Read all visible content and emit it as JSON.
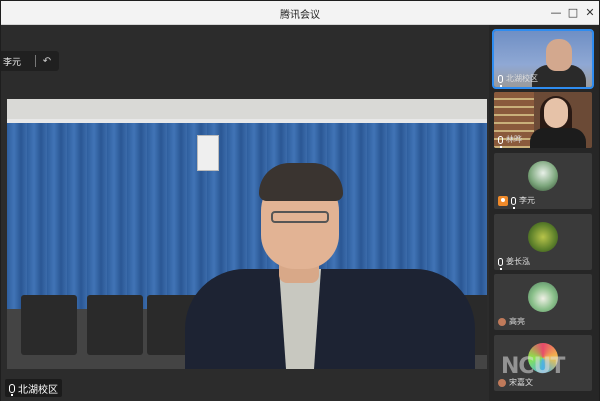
{
  "window": {
    "title": "腾讯会议"
  },
  "speaker_tag": {
    "name": "李元"
  },
  "main_video": {
    "label": "北湖校区"
  },
  "participants": [
    {
      "name": "北湖校区"
    },
    {
      "name": "林晔"
    },
    {
      "name": "李元"
    },
    {
      "name": "姜长泓"
    },
    {
      "name": "高亮"
    },
    {
      "name": "宋嘉文"
    }
  ],
  "watermark": "NCUT",
  "colors": {
    "active_border": "#2e8cf0",
    "host_badge": "#f08a2a"
  }
}
